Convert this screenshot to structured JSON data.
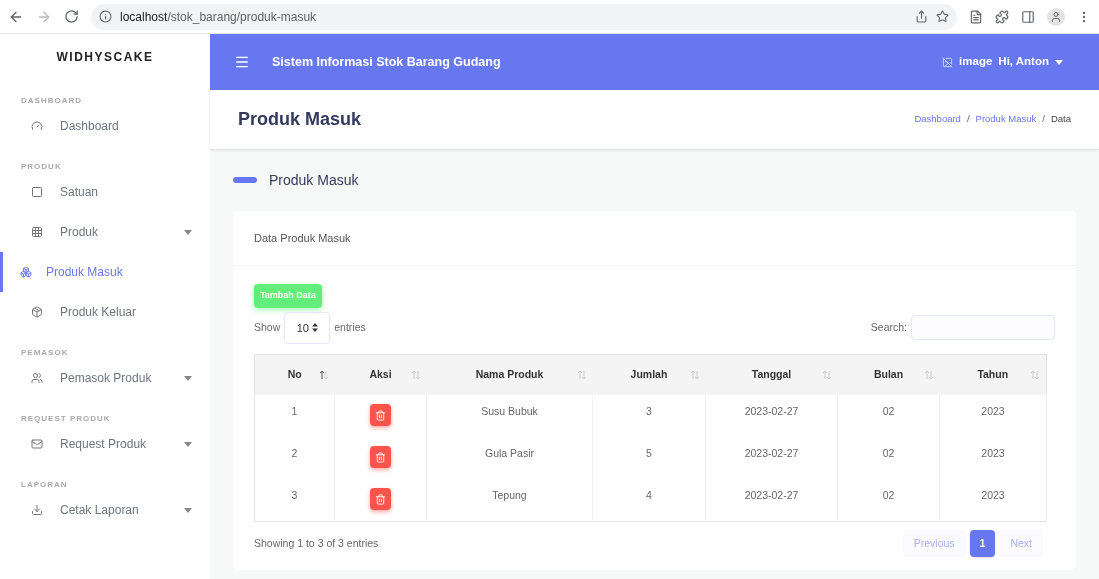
{
  "browser": {
    "url_host": "localhost",
    "url_path": "/stok_barang/produk-masuk"
  },
  "sidebar": {
    "brand": "WIDHYSCAKE",
    "items": [
      {
        "kind": "section",
        "label": "DASHBOARD"
      },
      {
        "kind": "item",
        "label": "Dashboard",
        "selected": false,
        "expandable": false
      },
      {
        "kind": "section",
        "label": "PRODUK"
      },
      {
        "kind": "item",
        "label": "Satuan",
        "selected": false,
        "expandable": false
      },
      {
        "kind": "item",
        "label": "Produk",
        "selected": false,
        "expandable": true
      },
      {
        "kind": "item",
        "label": "Produk Masuk",
        "selected": true,
        "expandable": false
      },
      {
        "kind": "item",
        "label": "Produk Keluar",
        "selected": false,
        "expandable": false
      },
      {
        "kind": "section",
        "label": "PEMASOK"
      },
      {
        "kind": "item",
        "label": "Pemasok Produk",
        "selected": false,
        "expandable": true
      },
      {
        "kind": "section",
        "label": "REQUEST PRODUK"
      },
      {
        "kind": "item",
        "label": "Request Produk",
        "selected": false,
        "expandable": true
      },
      {
        "kind": "section",
        "label": "LAPORAN"
      },
      {
        "kind": "item",
        "label": "Cetak Laporan",
        "selected": false,
        "expandable": true
      }
    ]
  },
  "topbar": {
    "title": "Sistem Informasi Stok Barang Gudang",
    "avatar_alt": "image",
    "user": "Hi, Anton"
  },
  "page_header": {
    "title": "Produk Masuk",
    "breadcrumb_separator": "/",
    "breadcrumb": [
      {
        "label": "Dashboard",
        "link": true
      },
      {
        "label": "Produk Masuk",
        "link": true
      },
      {
        "label": "Data",
        "link": false
      }
    ]
  },
  "section_title": "Produk Masuk",
  "card": {
    "title": "Data Produk Masuk",
    "add_button": "Tambah Data",
    "show_label": "Show",
    "page_size": "10",
    "entries_label": "entries",
    "search_label": "Search:",
    "table": {
      "columns": [
        {
          "label": "No",
          "sorted": true
        },
        {
          "label": "Aksi",
          "sorted": false
        },
        {
          "label": "Nama Produk",
          "sorted": false
        },
        {
          "label": "Jumlah",
          "sorted": false
        },
        {
          "label": "Tanggal",
          "sorted": false
        },
        {
          "label": "Bulan",
          "sorted": false
        },
        {
          "label": "Tahun",
          "sorted": false
        }
      ],
      "rows": [
        {
          "no": "1",
          "nama": "Susu Bubuk",
          "jumlah": "3",
          "tanggal": "2023-02-27",
          "bulan": "02",
          "tahun": "2023"
        },
        {
          "no": "2",
          "nama": "Gula Pasir",
          "jumlah": "5",
          "tanggal": "2023-02-27",
          "bulan": "02",
          "tahun": "2023"
        },
        {
          "no": "3",
          "nama": "Tepung",
          "jumlah": "4",
          "tanggal": "2023-02-27",
          "bulan": "02",
          "tahun": "2023"
        }
      ]
    },
    "info": "Showing 1 to 3 of 3 entries",
    "pagination": [
      {
        "label": "Previous",
        "kind": "nav",
        "disabled": true,
        "selected": false
      },
      {
        "label": "1",
        "kind": "page",
        "disabled": false,
        "selected": true
      },
      {
        "label": "Next",
        "kind": "nav",
        "disabled": true,
        "selected": false
      }
    ]
  }
}
